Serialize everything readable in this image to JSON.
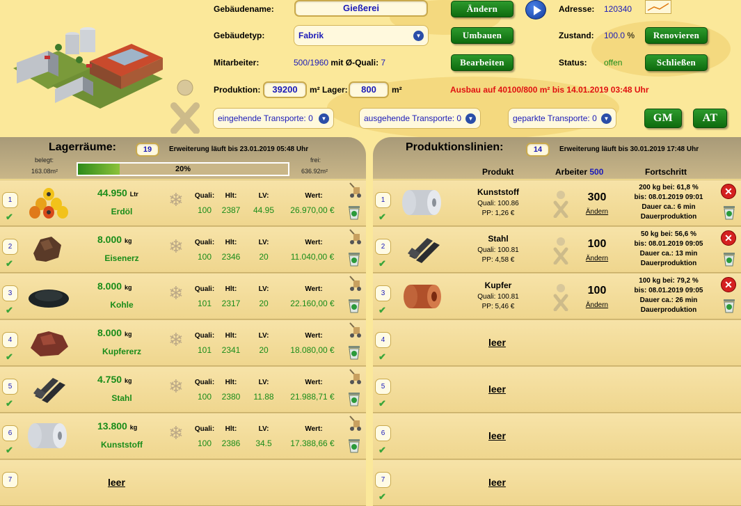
{
  "building": {
    "name_label": "Gebäudename:",
    "name_value": "Gießerei",
    "change_btn": "Ändern",
    "address_label": "Adresse:",
    "address_value": "120340",
    "type_label": "Gebäudetyp:",
    "type_value": "Fabrik",
    "rebuild_btn": "Umbauen",
    "condition_label": "Zustand:",
    "condition_value": "100.0",
    "condition_unit": "%",
    "renovate_btn": "Renovieren",
    "staff_label": "Mitarbeiter:",
    "staff_value": "500/1960",
    "staff_mid": "mit Ø-Quali:",
    "staff_quali": "7",
    "edit_btn": "Bearbeiten",
    "status_label": "Status:",
    "status_value": "offen",
    "close_btn": "Schließen",
    "production_label": "Produktion:",
    "production_value": "39200",
    "storage_label": "m² Lager:",
    "storage_value": "800",
    "storage_unit": "m²",
    "expansion_text": "Ausbau auf 40100/800 m² bis 14.01.2019 03:48 Uhr",
    "incoming": "eingehende Transporte: 0",
    "outgoing": "ausgehende Transporte: 0",
    "parked": "geparkte Transporte: 0",
    "gm_btn": "GM",
    "at_btn": "AT"
  },
  "storage": {
    "title": "Lagerräume:",
    "count": "19",
    "expansion": "Erweiterung läuft bis 23.01.2019 05:48 Uhr",
    "used_label": "belegt:",
    "used_value": "163.08m²",
    "free_label": "frei:",
    "free_value": "636.92m²",
    "percent_label": "20%",
    "percent": 20,
    "headers": {
      "quali": "Quali:",
      "hlt": "Hlt:",
      "lv": "LV:",
      "wert": "Wert:"
    },
    "rows": [
      {
        "num": "1",
        "amount": "44.950",
        "unit": "Ltr",
        "name": "Erdöl",
        "quali": "100",
        "hlt": "2387",
        "lv": "44.95",
        "wert": "26.970,00 €",
        "icon": "oil-barrels"
      },
      {
        "num": "2",
        "amount": "8.000",
        "unit": "kg",
        "name": "Eisenerz",
        "quali": "100",
        "hlt": "2346",
        "lv": "20",
        "wert": "11.040,00 €",
        "icon": "iron-ore"
      },
      {
        "num": "3",
        "amount": "8.000",
        "unit": "kg",
        "name": "Kohle",
        "quali": "101",
        "hlt": "2317",
        "lv": "20",
        "wert": "22.160,00 €",
        "icon": "coal"
      },
      {
        "num": "4",
        "amount": "8.000",
        "unit": "kg",
        "name": "Kupfererz",
        "quali": "101",
        "hlt": "2341",
        "lv": "20",
        "wert": "18.080,00 €",
        "icon": "copper-ore"
      },
      {
        "num": "5",
        "amount": "4.750",
        "unit": "kg",
        "name": "Stahl",
        "quali": "100",
        "hlt": "2380",
        "lv": "11.88",
        "wert": "21.988,71 €",
        "icon": "steel-beams"
      },
      {
        "num": "6",
        "amount": "13.800",
        "unit": "kg",
        "name": "Kunststoff",
        "quali": "100",
        "hlt": "2386",
        "lv": "34.5",
        "wert": "17.388,66 €",
        "icon": "plastic-roll"
      }
    ],
    "row7": {
      "num": "7",
      "leer": "leer"
    }
  },
  "production": {
    "title": "Produktionslinien:",
    "count": "14",
    "expansion": "Erweiterung läuft bis 30.01.2019 17:48 Uhr",
    "col_product": "Produkt",
    "col_workers": "Arbeiter",
    "col_workers_count": "500",
    "col_progress": "Fortschritt",
    "lines": [
      {
        "num": "1",
        "name": "Kunststoff",
        "quali": "Quali: 100.86",
        "pp": "PP: 1,26 €",
        "workers": "300",
        "change": "Ändern",
        "p1": "200 kg bei: 61,8 %",
        "p2": "bis: 08.01.2019 09:01",
        "p3": "Dauer ca.: 6 min",
        "p4": "Dauerproduktion",
        "icon": "plastic-roll"
      },
      {
        "num": "2",
        "name": "Stahl",
        "quali": "Quali: 100.81",
        "pp": "PP: 4,58 €",
        "workers": "100",
        "change": "Ändern",
        "p1": "50 kg bei: 56,6 %",
        "p2": "bis: 08.01.2019 09:05",
        "p3": "Dauer ca.: 13 min",
        "p4": "Dauerproduktion",
        "icon": "steel-beams"
      },
      {
        "num": "3",
        "name": "Kupfer",
        "quali": "Quali: 100.81",
        "pp": "PP: 5,46 €",
        "workers": "100",
        "change": "Ändern",
        "p1": "100 kg bei: 79,2 %",
        "p2": "bis: 08.01.2019 09:05",
        "p3": "Dauer ca.: 26 min",
        "p4": "Dauerproduktion",
        "icon": "copper-roll"
      }
    ],
    "empty": [
      {
        "num": "4",
        "leer": "leer"
      },
      {
        "num": "5",
        "leer": "leer"
      },
      {
        "num": "6",
        "leer": "leer"
      },
      {
        "num": "7",
        "leer": "leer"
      }
    ]
  }
}
